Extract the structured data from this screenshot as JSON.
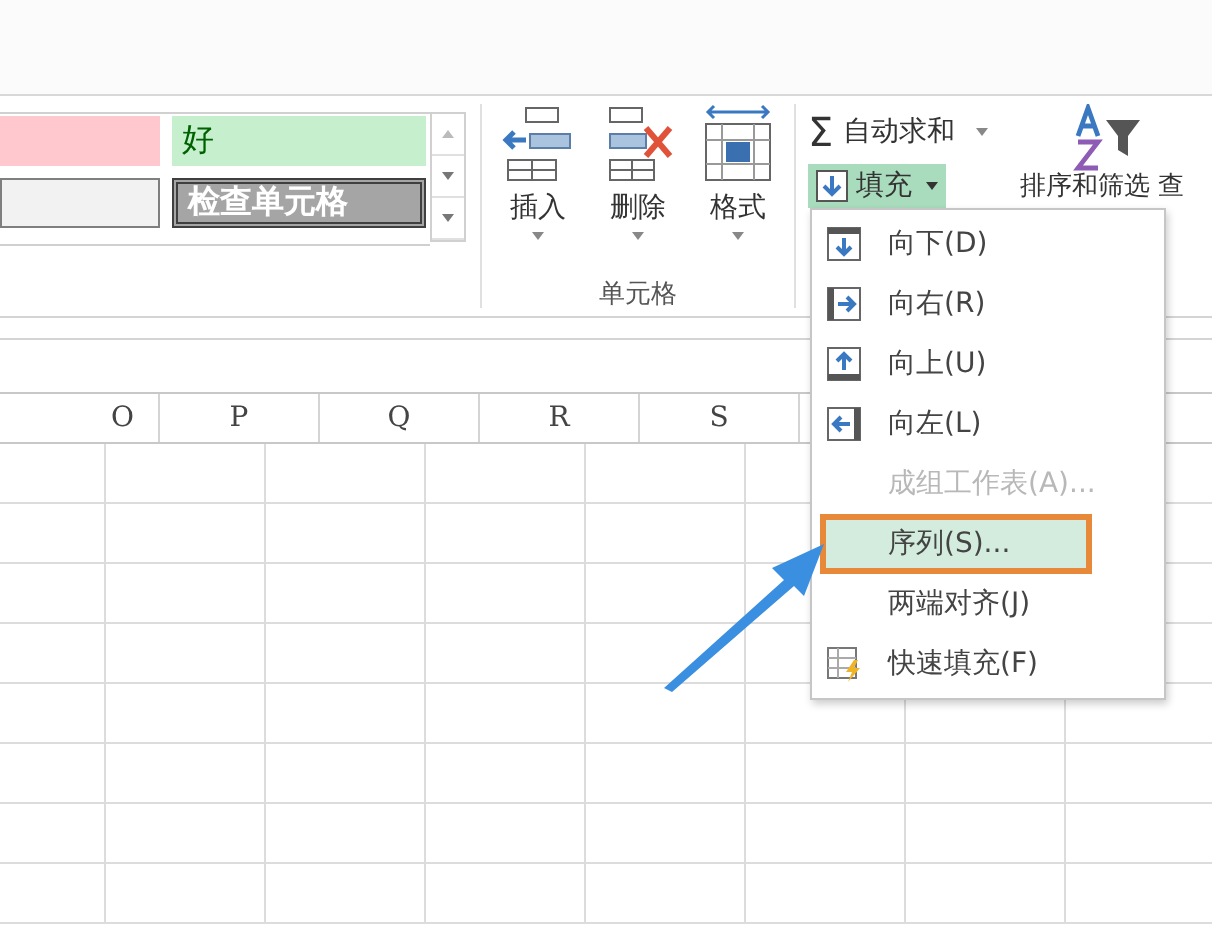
{
  "styles": [
    {
      "kind": "bad"
    },
    {
      "kind": "good",
      "label": "好"
    },
    {
      "kind": "neutral"
    },
    {
      "kind": "check",
      "label": "检查单元格"
    }
  ],
  "cells_group": {
    "buttons": [
      {
        "kind": "insert",
        "label": "插入"
      },
      {
        "kind": "delete",
        "label": "删除"
      },
      {
        "kind": "format",
        "label": "格式"
      }
    ],
    "group_label": "单元格"
  },
  "editing": {
    "autosum": {
      "symbol": "Σ",
      "label": "自动求和"
    },
    "fill": {
      "label": "填充",
      "expanded": true
    },
    "sort_filter": {
      "label": "排序和筛选",
      "label_2": "查"
    }
  },
  "columns": [
    "O",
    "P",
    "Q",
    "R",
    "S"
  ],
  "fill_menu": [
    {
      "kind": "down",
      "label": "向下(D)",
      "disabled": false,
      "selected": false
    },
    {
      "kind": "right",
      "label": "向右(R)",
      "disabled": false,
      "selected": false
    },
    {
      "kind": "up",
      "label": "向上(U)",
      "disabled": false,
      "selected": false
    },
    {
      "kind": "left",
      "label": "向左(L)",
      "disabled": false,
      "selected": false
    },
    {
      "kind": "none",
      "label": "成组工作表(A)...",
      "disabled": true,
      "selected": false
    },
    {
      "kind": "none",
      "label": "序列(S)...",
      "disabled": false,
      "selected": true
    },
    {
      "kind": "none",
      "label": "两端对齐(J)",
      "disabled": false,
      "selected": false
    },
    {
      "kind": "flash",
      "label": "快速填充(F)",
      "disabled": false,
      "selected": false
    }
  ]
}
